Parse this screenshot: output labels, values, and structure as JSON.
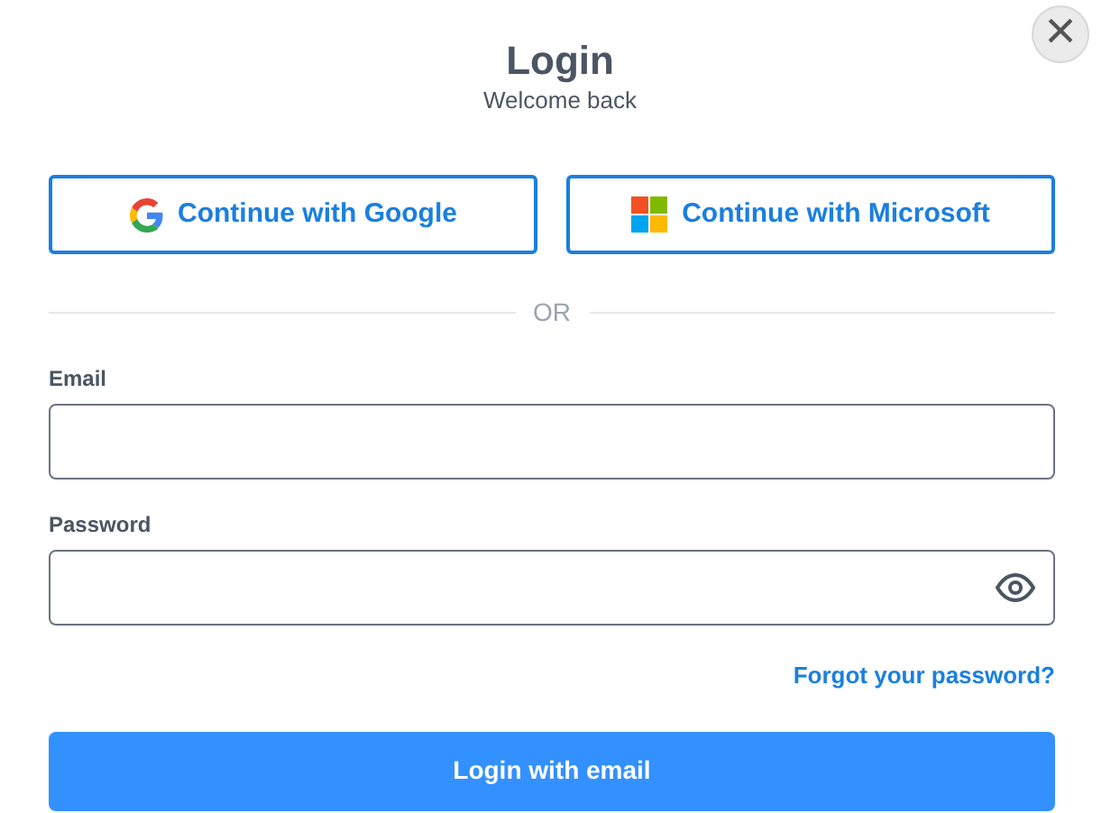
{
  "dialog": {
    "title": "Login",
    "subtitle": "Welcome back",
    "close_label": "×"
  },
  "social_buttons": [
    {
      "kind": "google",
      "label": "Continue with Google"
    },
    {
      "kind": "microsoft",
      "label": "Continue with Microsoft"
    }
  ],
  "divider": "OR",
  "fields": [
    {
      "kind": "email",
      "label": "Email"
    },
    {
      "kind": "password",
      "label": "Password"
    }
  ],
  "forgot_link": "Forgot your password?",
  "submit_button": "Login with email"
}
